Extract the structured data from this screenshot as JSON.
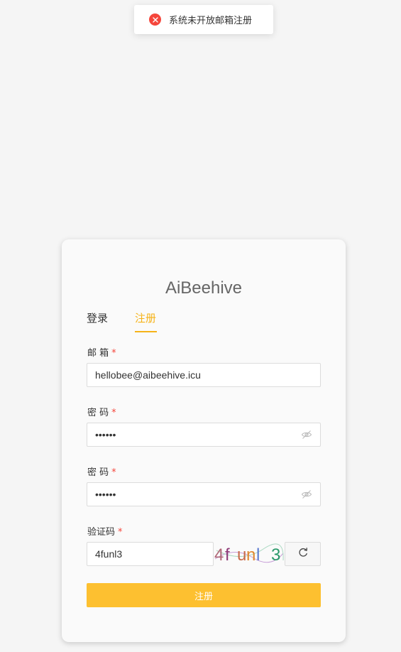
{
  "toast": {
    "message": "系统未开放邮箱注册",
    "icon": "error-circle-icon",
    "icon_color": "#f5463c"
  },
  "brand": {
    "title": "AiBeehive"
  },
  "tabs": {
    "login": "登录",
    "register": "注册",
    "active": "register",
    "accent_color": "#f6b318"
  },
  "form": {
    "required_mark": "*",
    "email": {
      "label": "邮 箱",
      "value": "hellobee@aibeehive.icu"
    },
    "password": {
      "label": "密 码",
      "value": "••••••",
      "toggle_icon": "eye-hidden-icon"
    },
    "confirm_password": {
      "label": "密 码",
      "value": "••••••",
      "toggle_icon": "eye-hidden-icon"
    },
    "captcha": {
      "label": "验证码",
      "value": "4funl3",
      "image_text": "4f unl 3",
      "refresh_icon": "refresh-icon"
    },
    "submit_label": "注册",
    "submit_color": "#fdc030"
  }
}
